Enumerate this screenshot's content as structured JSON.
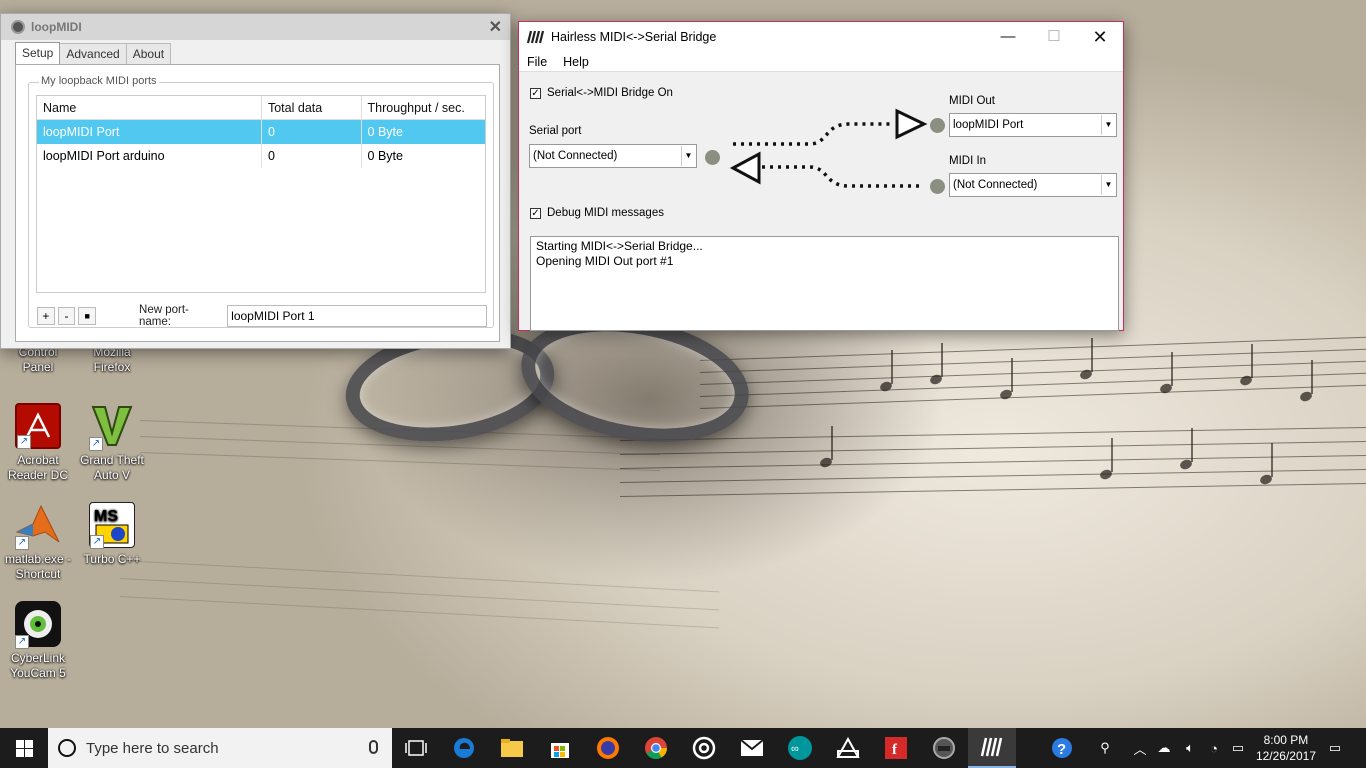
{
  "desktop": {
    "icons": [
      {
        "label_1": "Control",
        "label_2": "Panel",
        "icon": "control-panel-icon"
      },
      {
        "label_1": "Mozilla",
        "label_2": "Firefox",
        "icon": "firefox-icon"
      },
      {
        "label_1": "Acrobat",
        "label_2": "Reader DC",
        "icon": "acrobat-icon"
      },
      {
        "label_1": "Grand Theft",
        "label_2": "Auto V",
        "icon": "gta-icon"
      },
      {
        "label_1": "matlab.exe -",
        "label_2": "Shortcut",
        "icon": "matlab-icon"
      },
      {
        "label_1": "Turbo C++",
        "label_2": "",
        "icon": "turbo-cpp-icon"
      },
      {
        "label_1": "CyberLink",
        "label_2": "YouCam 5",
        "icon": "youcam-icon"
      }
    ]
  },
  "loopmidi": {
    "title": "loopMIDI",
    "tabs": [
      "Setup",
      "Advanced",
      "About"
    ],
    "active_tab": "Setup",
    "group_label": "My loopback MIDI ports",
    "columns": [
      "Name",
      "Total data",
      "Throughput / sec."
    ],
    "rows": [
      {
        "name": "loopMIDI Port",
        "total": "0",
        "throughput": "0 Byte",
        "selected": true
      },
      {
        "name": "loopMIDI Port arduino",
        "total": "0",
        "throughput": "0 Byte",
        "selected": false
      }
    ],
    "buttons": {
      "add": "+",
      "remove": "-",
      "stop": "■"
    },
    "new_port_label": "New port-name:",
    "new_port_value": "loopMIDI Port 1"
  },
  "hairless": {
    "title": "Hairless MIDI<->Serial Bridge",
    "menu": [
      "File",
      "Help"
    ],
    "bridge_on_label": "Serial<->MIDI Bridge On",
    "bridge_on_checked": true,
    "serial_port_label": "Serial port",
    "serial_port_value": "(Not Connected)",
    "midi_out_label": "MIDI Out",
    "midi_out_value": "loopMIDI Port",
    "midi_in_label": "MIDI In",
    "midi_in_value": "(Not Connected)",
    "debug_label": "Debug MIDI messages",
    "debug_checked": true,
    "log_lines": [
      "Starting MIDI<->Serial Bridge...",
      "Opening MIDI Out port #1"
    ]
  },
  "taskbar": {
    "search_placeholder": "Type here to search",
    "time": "8:00 PM",
    "date": "12/26/2017"
  },
  "colors": {
    "selection": "#51c8ef",
    "hairless_border": "#c0305a",
    "taskbar": "#1c1c1c"
  }
}
